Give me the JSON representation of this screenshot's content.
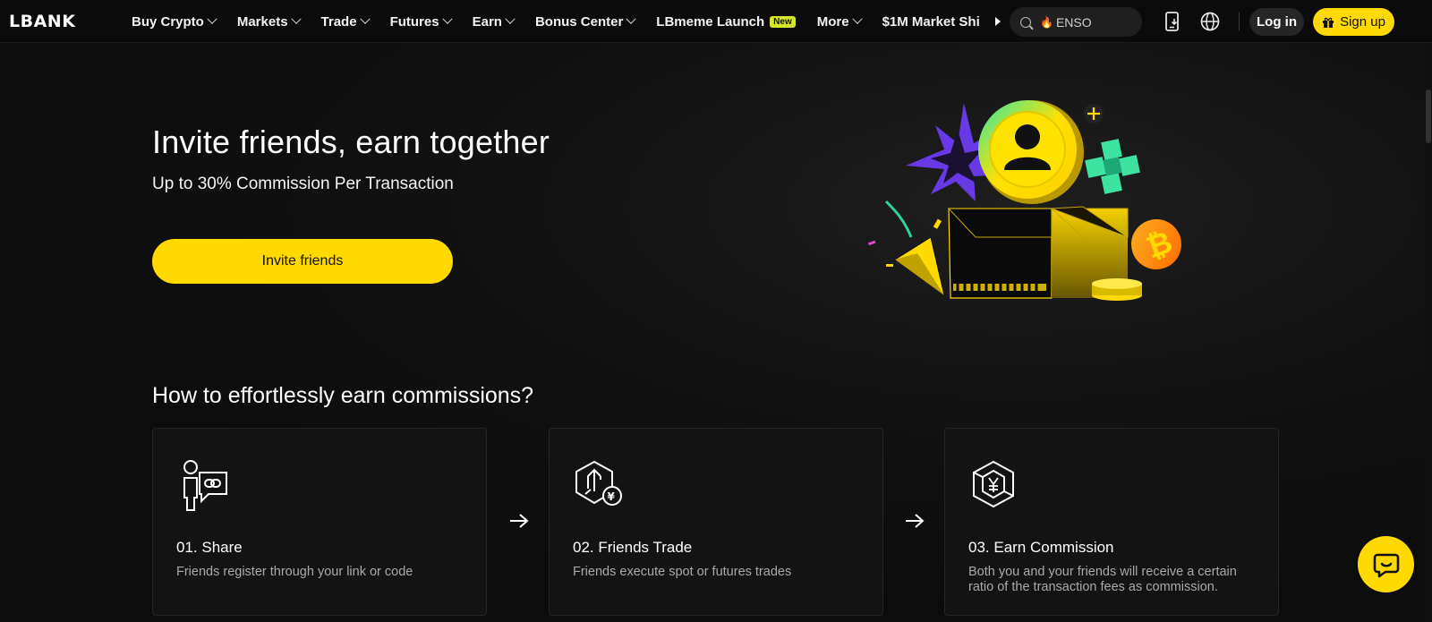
{
  "nav": {
    "logo": "LBANK",
    "items": [
      {
        "label": "Buy Crypto",
        "dropdown": true
      },
      {
        "label": "Markets",
        "dropdown": true
      },
      {
        "label": "Trade",
        "dropdown": true
      },
      {
        "label": "Futures",
        "dropdown": true
      },
      {
        "label": "Earn",
        "dropdown": true
      },
      {
        "label": "Bonus Center",
        "dropdown": true
      },
      {
        "label": "LBmeme Launch",
        "badge": "New"
      },
      {
        "label": "More",
        "dropdown": true
      },
      {
        "label": "$1M Market Shi"
      }
    ],
    "search_placeholder": "ENSO",
    "login_label": "Log in",
    "signup_label": "Sign up"
  },
  "hero": {
    "title": "Invite friends, earn together",
    "subtitle": "Up to 30% Commission Per Transaction",
    "cta_label": "Invite friends"
  },
  "how": {
    "title": "How to effortlessly earn commissions?",
    "steps": [
      {
        "title": "01. Share",
        "desc": "Friends register through your link or code",
        "icon": "share-link-icon"
      },
      {
        "title": "02. Friends Trade",
        "desc": "Friends execute spot or futures trades",
        "icon": "trade-exchange-icon"
      },
      {
        "title": "03. Earn Commission",
        "desc": "Both you and your friends will receive a certain ratio of the transaction fees as commission.",
        "icon": "commission-yen-icon"
      }
    ]
  },
  "colors": {
    "accent": "#ffd900",
    "background": "#0d0d0d",
    "card": "#131313",
    "muted_text": "#a9a9a9"
  }
}
